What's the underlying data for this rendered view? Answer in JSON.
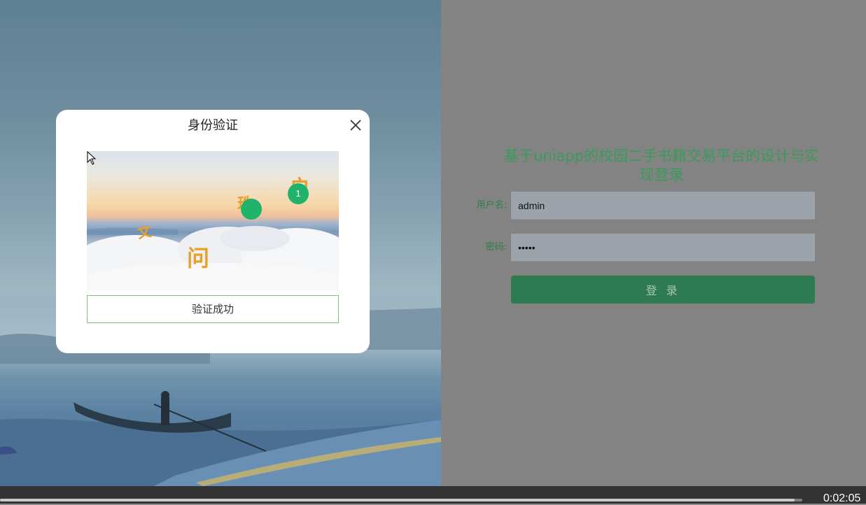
{
  "login": {
    "title": "基于uniapp的校园二手书籍交易平台的设计与实现登录",
    "username_label": "用户名:",
    "username_value": "admin",
    "password_label": "密码:",
    "password_value": "•••••",
    "login_button": "登 录"
  },
  "modal": {
    "title": "身份验证",
    "close_icon": "close-icon",
    "captcha_chars": [
      "文",
      "珠",
      "问",
      "户"
    ],
    "click_markers": [
      "1"
    ],
    "verify_status": "验证成功"
  },
  "video": {
    "time": "0:02:05",
    "progress": 0.99
  },
  "colors": {
    "accent_green": "#3b9a5c",
    "button_green": "#2e7a51",
    "marker_green": "#21b36a",
    "captcha_char": "#e8a02d"
  }
}
